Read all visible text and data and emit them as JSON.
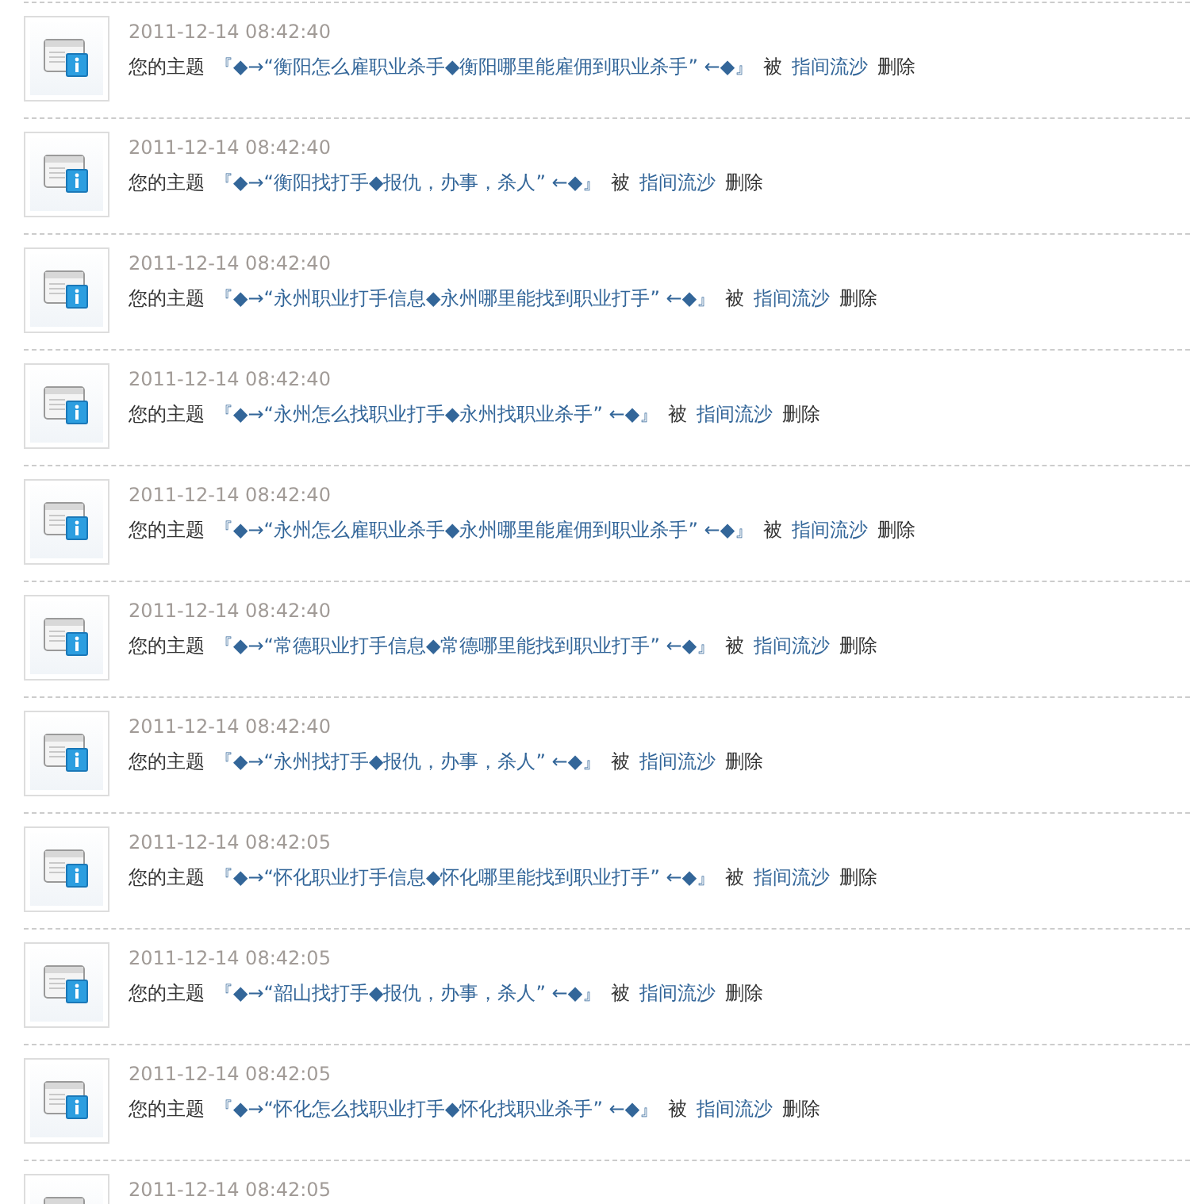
{
  "notices": [
    {
      "time": "2011-12-14 08:42:40",
      "prefix": "您的主题",
      "subject": "『◆→“衡阳怎么雇职业杀手◆衡阳哪里能雇佣到职业杀手” ←◆』",
      "by": "被",
      "user": "指间流沙",
      "action": "删除"
    },
    {
      "time": "2011-12-14 08:42:40",
      "prefix": "您的主题",
      "subject": "『◆→“衡阳找打手◆报仇，办事，杀人” ←◆』",
      "by": "被",
      "user": "指间流沙",
      "action": "删除"
    },
    {
      "time": "2011-12-14 08:42:40",
      "prefix": "您的主题",
      "subject": "『◆→“永州职业打手信息◆永州哪里能找到职业打手” ←◆』",
      "by": "被",
      "user": "指间流沙",
      "action": "删除"
    },
    {
      "time": "2011-12-14 08:42:40",
      "prefix": "您的主题",
      "subject": "『◆→“永州怎么找职业打手◆永州找职业杀手” ←◆』",
      "by": "被",
      "user": "指间流沙",
      "action": "删除"
    },
    {
      "time": "2011-12-14 08:42:40",
      "prefix": "您的主题",
      "subject": "『◆→“永州怎么雇职业杀手◆永州哪里能雇佣到职业杀手” ←◆』",
      "by": "被",
      "user": "指间流沙",
      "action": "删除"
    },
    {
      "time": "2011-12-14 08:42:40",
      "prefix": "您的主题",
      "subject": "『◆→“常德职业打手信息◆常德哪里能找到职业打手” ←◆』",
      "by": "被",
      "user": "指间流沙",
      "action": "删除"
    },
    {
      "time": "2011-12-14 08:42:40",
      "prefix": "您的主题",
      "subject": "『◆→“永州找打手◆报仇，办事，杀人” ←◆』",
      "by": "被",
      "user": "指间流沙",
      "action": "删除"
    },
    {
      "time": "2011-12-14 08:42:05",
      "prefix": "您的主题",
      "subject": "『◆→“怀化职业打手信息◆怀化哪里能找到职业打手” ←◆』",
      "by": "被",
      "user": "指间流沙",
      "action": "删除"
    },
    {
      "time": "2011-12-14 08:42:05",
      "prefix": "您的主题",
      "subject": "『◆→“韶山找打手◆报仇，办事，杀人” ←◆』",
      "by": "被",
      "user": "指间流沙",
      "action": "删除"
    },
    {
      "time": "2011-12-14 08:42:05",
      "prefix": "您的主题",
      "subject": "『◆→“怀化怎么找职业打手◆怀化找职业杀手” ←◆』",
      "by": "被",
      "user": "指间流沙",
      "action": "删除"
    },
    {
      "time": "2011-12-14 08:42:05"
    }
  ]
}
